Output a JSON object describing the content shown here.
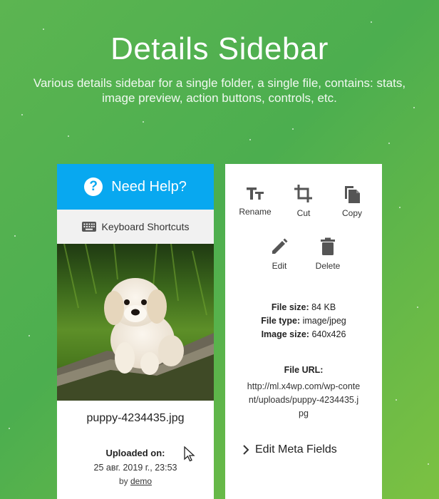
{
  "hero": {
    "title": "Details Sidebar",
    "subtitle": "Various details sidebar for a single folder, a single file, contains: stats, image preview, action buttons, controls, etc."
  },
  "left_panel": {
    "help_label": "Need Help?",
    "help_icon": "question-circle-icon",
    "shortcuts_label": "Keyboard Shortcuts",
    "shortcuts_icon": "keyboard-icon",
    "preview_alt": "puppy photo",
    "file_name": "puppy-4234435.jpg",
    "uploaded_label": "Uploaded on:",
    "uploaded_date": "25 авг. 2019 г., 23:53",
    "uploaded_by_prefix": "by",
    "uploaded_by_user": "demo"
  },
  "right_panel": {
    "actions_row1": [
      {
        "label": "Rename",
        "icon": "text-size-icon"
      },
      {
        "label": "Cut",
        "icon": "crop-icon"
      },
      {
        "label": "Copy",
        "icon": "copy-icon"
      }
    ],
    "actions_row2": [
      {
        "label": "Edit",
        "icon": "pencil-icon"
      },
      {
        "label": "Delete",
        "icon": "trash-icon"
      }
    ],
    "stats": {
      "file_size_label": "File size:",
      "file_size": "84 KB",
      "file_type_label": "File type:",
      "file_type": "image/jpeg",
      "image_size_label": "Image size:",
      "image_size": "640x426"
    },
    "file_url_label": "File URL:",
    "file_url": "http://ml.x4wp.com/wp-content/uploads/puppy-4234435.jpg",
    "meta_label": "Edit Meta Fields"
  },
  "colors": {
    "accent_blue": "#08a8f0",
    "background_green": "#4cae4f",
    "icon_gray": "#555555"
  }
}
